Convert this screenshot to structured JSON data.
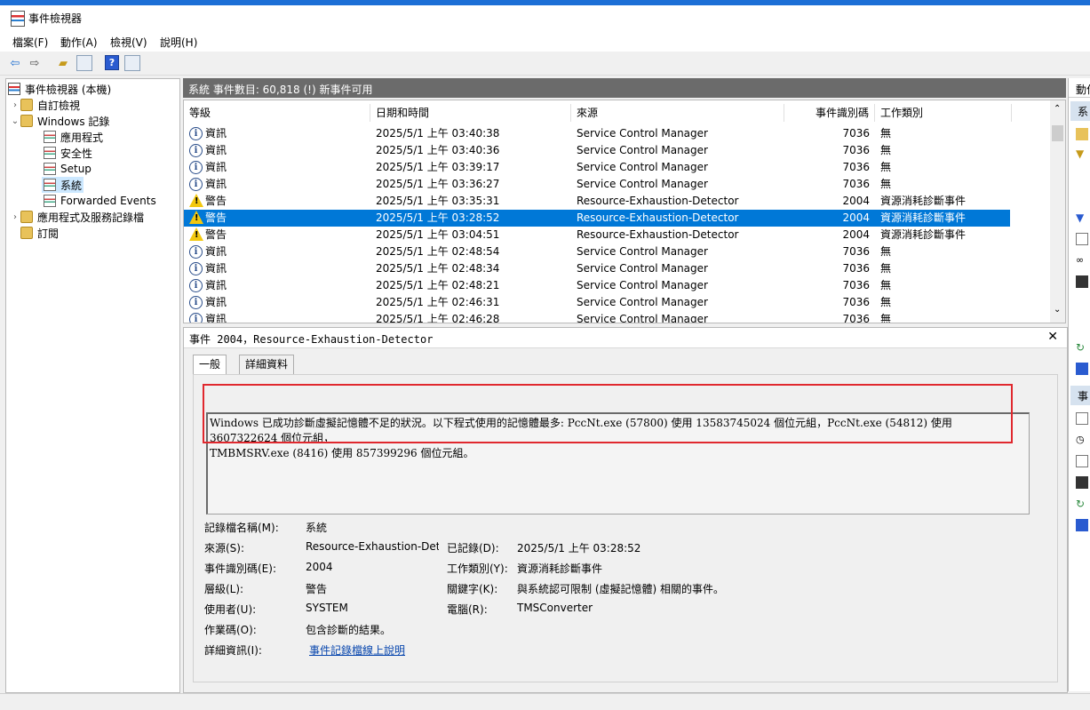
{
  "window": {
    "title": "事件檢視器"
  },
  "menu": [
    "檔案(F)",
    "動作(A)",
    "檢視(V)",
    "說明(H)"
  ],
  "tree": {
    "root": "事件檢視器 (本機)",
    "custom_views": "自訂檢視",
    "windows_logs": "Windows 記錄",
    "logs": [
      "應用程式",
      "安全性",
      "Setup",
      "系統",
      "Forwarded Events"
    ],
    "app_services": "應用程式及服務記錄檔",
    "subscriptions": "訂閱"
  },
  "main": {
    "header": "系統    事件數目: 60,818 (!) 新事件可用",
    "columns": {
      "level": "等級",
      "datetime": "日期和時間",
      "source": "來源",
      "event_id": "事件識別碼",
      "task": "工作類別"
    },
    "rows": [
      {
        "icon": "info-icon",
        "level": "資訊",
        "datetime": "2025/5/1 上午 03:40:38",
        "source": "Service Control Manager",
        "id": "7036",
        "task": "無"
      },
      {
        "icon": "info-icon",
        "level": "資訊",
        "datetime": "2025/5/1 上午 03:40:36",
        "source": "Service Control Manager",
        "id": "7036",
        "task": "無"
      },
      {
        "icon": "info-icon",
        "level": "資訊",
        "datetime": "2025/5/1 上午 03:39:17",
        "source": "Service Control Manager",
        "id": "7036",
        "task": "無"
      },
      {
        "icon": "info-icon",
        "level": "資訊",
        "datetime": "2025/5/1 上午 03:36:27",
        "source": "Service Control Manager",
        "id": "7036",
        "task": "無"
      },
      {
        "icon": "warning-icon",
        "level": "警告",
        "datetime": "2025/5/1 上午 03:35:31",
        "source": "Resource-Exhaustion-Detector",
        "id": "2004",
        "task": "資源消耗診斷事件"
      },
      {
        "icon": "warning-icon",
        "level": "警告",
        "datetime": "2025/5/1 上午 03:28:52",
        "source": "Resource-Exhaustion-Detector",
        "id": "2004",
        "task": "資源消耗診斷事件",
        "selected": true
      },
      {
        "icon": "warning-icon",
        "level": "警告",
        "datetime": "2025/5/1 上午 03:04:51",
        "source": "Resource-Exhaustion-Detector",
        "id": "2004",
        "task": "資源消耗診斷事件"
      },
      {
        "icon": "info-icon",
        "level": "資訊",
        "datetime": "2025/5/1 上午 02:48:54",
        "source": "Service Control Manager",
        "id": "7036",
        "task": "無"
      },
      {
        "icon": "info-icon",
        "level": "資訊",
        "datetime": "2025/5/1 上午 02:48:34",
        "source": "Service Control Manager",
        "id": "7036",
        "task": "無"
      },
      {
        "icon": "info-icon",
        "level": "資訊",
        "datetime": "2025/5/1 上午 02:48:21",
        "source": "Service Control Manager",
        "id": "7036",
        "task": "無"
      },
      {
        "icon": "info-icon",
        "level": "資訊",
        "datetime": "2025/5/1 上午 02:46:31",
        "source": "Service Control Manager",
        "id": "7036",
        "task": "無"
      },
      {
        "icon": "info-icon",
        "level": "資訊",
        "datetime": "2025/5/1 上午 02:46:28",
        "source": "Service Control Manager",
        "id": "7036",
        "task": "無"
      }
    ]
  },
  "detail": {
    "title": "事件 2004，Resource-Exhaustion-Detector",
    "tabs": [
      "一般",
      "詳細資料"
    ],
    "message_line1": "Windows 已成功診斷虛擬記憶體不足的狀況。以下程式使用的記憶體最多: PccNt.exe (57800) 使用 13583745024 個位元組，PccNt.exe (54812) 使用 3607322624 個位元組，",
    "message_line2": "TMBMSRV.exe (8416) 使用 857399296 個位元組。",
    "fields": {
      "log_name_label": "記錄檔名稱(M):",
      "log_name": "系統",
      "source_label": "來源(S):",
      "source": "Resource-Exhaustion-Detect",
      "logged_label": "已記錄(D):",
      "logged": "2025/5/1 上午 03:28:52",
      "event_id_label": "事件識別碼(E):",
      "event_id": "2004",
      "task_label": "工作類別(Y):",
      "task": "資源消耗診斷事件",
      "level_label": "層級(L):",
      "level": "警告",
      "keywords_label": "關鍵字(K):",
      "keywords": "與系統認可限制 (虛擬記憶體) 相關的事件。",
      "user_label": "使用者(U):",
      "user": "SYSTEM",
      "computer_label": "電腦(R):",
      "computer": "TMSConverter",
      "opcode_label": "作業碼(O):",
      "opcode": "包含診斷的結果。",
      "more_label": "詳細資訊(I):",
      "more_link": "事件記錄檔線上說明"
    }
  },
  "actions": {
    "header": "動作",
    "section1": "系",
    "section2": "事"
  }
}
